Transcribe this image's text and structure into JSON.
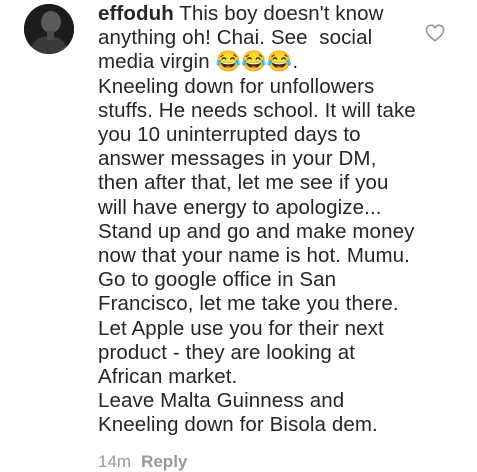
{
  "comment": {
    "username": "effoduh",
    "text": "This boy doesn't know anything oh! Chai. See  social media virgin 😂😂😂.\nKneeling down for unfollowers stuffs. He needs school. It will take you 10 uninterrupted days to answer messages in your DM, then after that, let me see if you will have energy to apologize...\nStand up and go and make money now that your name is hot. Mumu. Go to google office in San Francisco, let me take you there. Let Apple use you for their next product - they are looking at African market.\nLeave Malta Guinness and Kneeling down for Bisola dem.",
    "timestamp": "14m",
    "reply_label": "Reply",
    "like_icon": "heart-outline-icon",
    "avatar": "profile-photo"
  },
  "colors": {
    "text": "#262626",
    "meta": "#999999",
    "icon": "#999999"
  }
}
